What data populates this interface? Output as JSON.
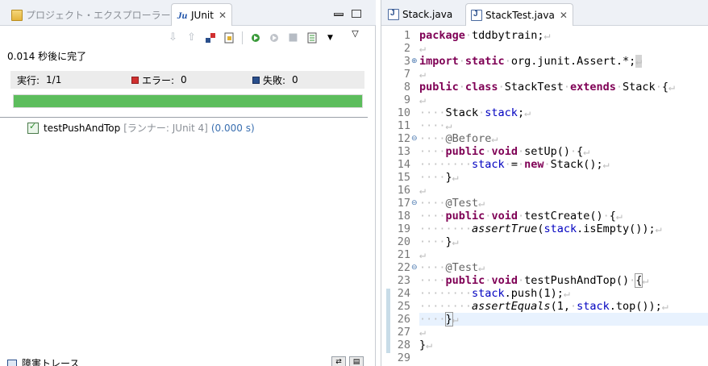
{
  "left_tabs": {
    "explorer": "プロジェクト・エクスプローラー",
    "junit": "JUnit"
  },
  "junit": {
    "status": "0.014 秒後に完了",
    "runs_label": "実行:",
    "runs_value": "1/1",
    "errors_label": "エラー:",
    "errors_value": "0",
    "failures_label": "失敗:",
    "failures_value": "0",
    "progress": 1.0,
    "test_name": "testPushAndTop",
    "test_runner": "[ランナー: JUnit 4]",
    "test_time": "(0.000 s)",
    "trace_title": "障害トレース"
  },
  "editor_tabs": {
    "tab1": "Stack.java",
    "tab2": "StackTest.java"
  },
  "code": {
    "line_numbers": [
      "1",
      "2",
      "3",
      "7",
      "8",
      "9",
      "10",
      "11",
      "12",
      "13",
      "14",
      "15",
      "16",
      "17",
      "18",
      "19",
      "20",
      "21",
      "22",
      "23",
      "24",
      "25",
      "26",
      "27",
      "28",
      "29"
    ],
    "current_line": "26"
  },
  "colors": {
    "keyword": "#7f0055",
    "field": "#0000c0",
    "annotation": "#646464",
    "progress_green": "#5cbd5c"
  }
}
